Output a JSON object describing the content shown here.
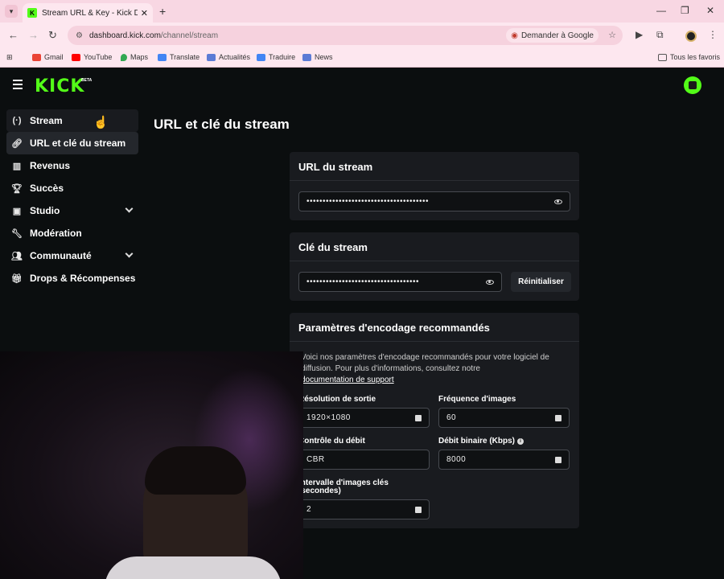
{
  "browser": {
    "tab_title": "Stream URL & Key - Kick Dashb",
    "tab_favicon": "K",
    "url_host": "dashboard.kick.com",
    "url_path": "/channel/stream",
    "ask_google": "Demander à Google",
    "bookmarks": [
      "Gmail",
      "YouTube",
      "Maps",
      "Translate",
      "Actualités",
      "Traduire",
      "News"
    ],
    "all_bookmarks": "Tous les favoris"
  },
  "app": {
    "brand_color": "#53fc18",
    "logo": "KICK",
    "logo_badge": "BETA"
  },
  "sidebar": {
    "items": [
      {
        "label": "Stream",
        "icon": "broadcast-icon"
      },
      {
        "label": "URL et clé du stream",
        "icon": "link-icon"
      },
      {
        "label": "Revenus",
        "icon": "bar-chart-icon"
      },
      {
        "label": "Succès",
        "icon": "trophy-icon"
      },
      {
        "label": "Studio",
        "icon": "studio-icon"
      },
      {
        "label": "Modération",
        "icon": "wrench-icon"
      },
      {
        "label": "Communauté",
        "icon": "users-icon"
      },
      {
        "label": "Drops & Récompenses",
        "icon": "gift-icon"
      }
    ]
  },
  "page": {
    "title": "URL et clé du stream"
  },
  "stream_url": {
    "heading": "URL du stream",
    "masked_value": "••••••••••••••••••••••••••••••••••••••"
  },
  "stream_key": {
    "heading": "Clé du stream",
    "masked_value": "•••••••••••••••••••••••••••••••••••",
    "reset_label": "Réinitialiser"
  },
  "encoding": {
    "heading": "Paramètres d'encodage recommandés",
    "desc_line1": "Voici nos paramètres d'encodage recommandés pour votre logiciel de",
    "desc_line2": "diffusion. Pour plus d'informations, consultez notre",
    "support_link": "documentation de support",
    "resolution_label": "Résolution de sortie",
    "resolution_value": "1920×1080",
    "fps_label": "Fréquence d'images",
    "fps_value": "60",
    "rate_control_label": "Contrôle du débit",
    "rate_control_value": "CBR",
    "bitrate_label": "Débit binaire (Kbps)",
    "bitrate_value": "8000",
    "keyframe_label_1": "Intervalle d'images clés",
    "keyframe_label_2": "(secondes)",
    "keyframe_value": "2"
  }
}
